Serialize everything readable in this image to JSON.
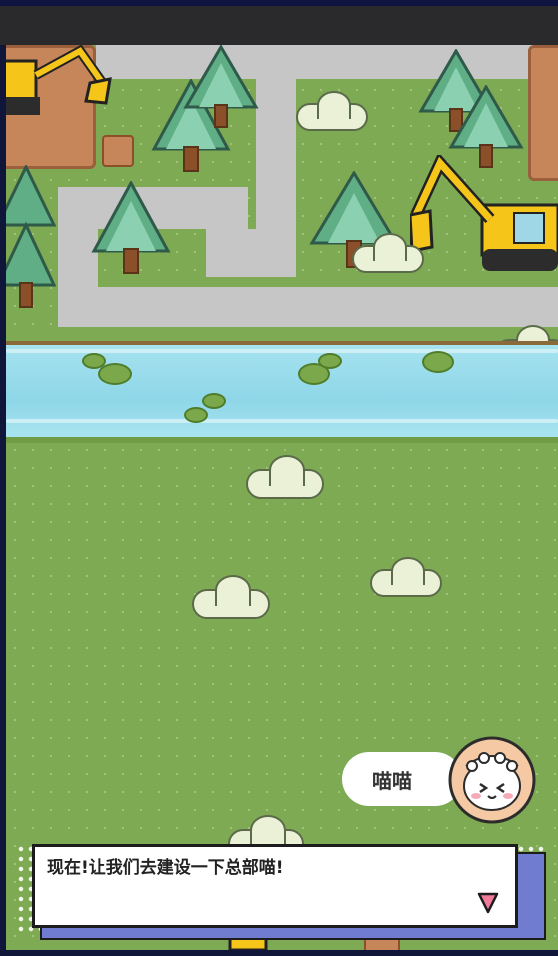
{
  "topbar": {},
  "scene": {
    "objects": {
      "clouds": [
        "cloud",
        "cloud",
        "cloud",
        "cloud",
        "cloud",
        "cloud",
        "cloud",
        "cloud"
      ],
      "excavators": [
        "excavator",
        "excavator",
        "excavator"
      ],
      "trees": [
        "tree",
        "tree",
        "tree",
        "tree",
        "tree",
        "tree",
        "tree"
      ]
    }
  },
  "dialogue": {
    "speaker": "喵喵",
    "text": "现在!让我们去建设一下总部喵!",
    "next_icon": "triangle-down-icon"
  },
  "colors": {
    "grass": "#7daa52",
    "road": "#c6c6c6",
    "river": "#8ed6e8",
    "dialog_accent": "#6f7ccf",
    "next_arrow": "#f07a9a",
    "avatar_bg": "#f4c9a4"
  }
}
